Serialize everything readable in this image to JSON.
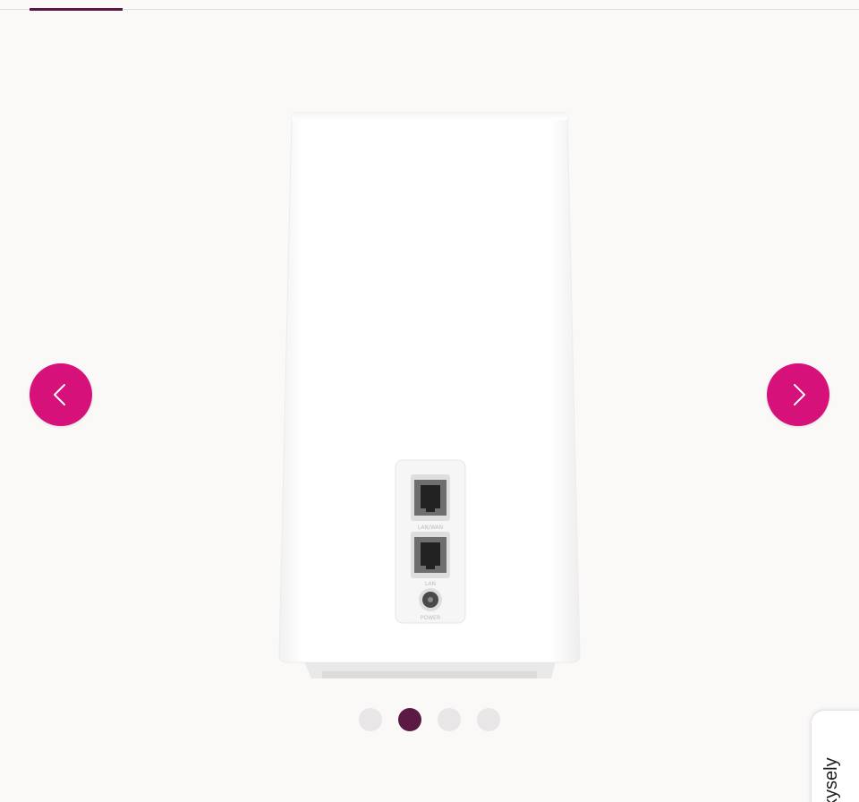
{
  "carousel": {
    "slides_total": 4,
    "active_index": 1,
    "dots": [
      {
        "label": "Slide 1"
      },
      {
        "label": "Slide 2"
      },
      {
        "label": "Slide 3"
      },
      {
        "label": "Slide 4"
      }
    ],
    "prev_icon": "chevron-left-icon",
    "next_icon": "chevron-right-icon"
  },
  "product": {
    "port_labels": [
      "LAN/WAN",
      "LAN",
      "POWER"
    ]
  },
  "side_tab": {
    "label": "skysely"
  },
  "colors": {
    "accent": "#d6117a",
    "dot_active": "#5b1a44",
    "dot_inactive": "#e8e6e6",
    "background": "#faf9f8"
  }
}
